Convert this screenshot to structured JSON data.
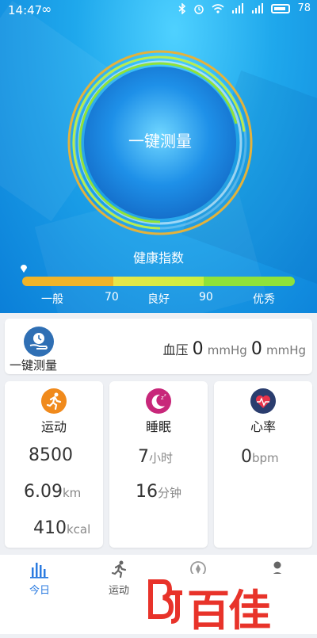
{
  "status_bar": {
    "time": "14:47",
    "infinity": "∞",
    "battery": "78"
  },
  "gauge": {
    "label": "一键测量"
  },
  "health_index": {
    "title": "健康指数",
    "scale": [
      "一般",
      "70",
      "良好",
      "90",
      "优秀"
    ],
    "colors": [
      "#f0b429",
      "#d8ec44",
      "#8fe23a"
    ]
  },
  "measure_card": {
    "label": "一键测量",
    "bp_label": "血压",
    "systolic": "0",
    "diastolic": "0",
    "unit": "mmHg"
  },
  "sport": {
    "title": "运动",
    "steps": "8500",
    "distance": "6.09",
    "distance_unit": "km",
    "calories": "410",
    "calories_unit": "kcal"
  },
  "sleep": {
    "title": "睡眠",
    "hours": "7",
    "hours_unit": "小时",
    "minutes": "16",
    "minutes_unit": "分钟"
  },
  "heart": {
    "title": "心率",
    "bpm": "0",
    "bpm_unit": "bpm"
  },
  "tabs": [
    {
      "label": "今日",
      "active": true
    },
    {
      "label": "运动",
      "active": false
    }
  ],
  "watermark": {
    "text": "百佳"
  }
}
